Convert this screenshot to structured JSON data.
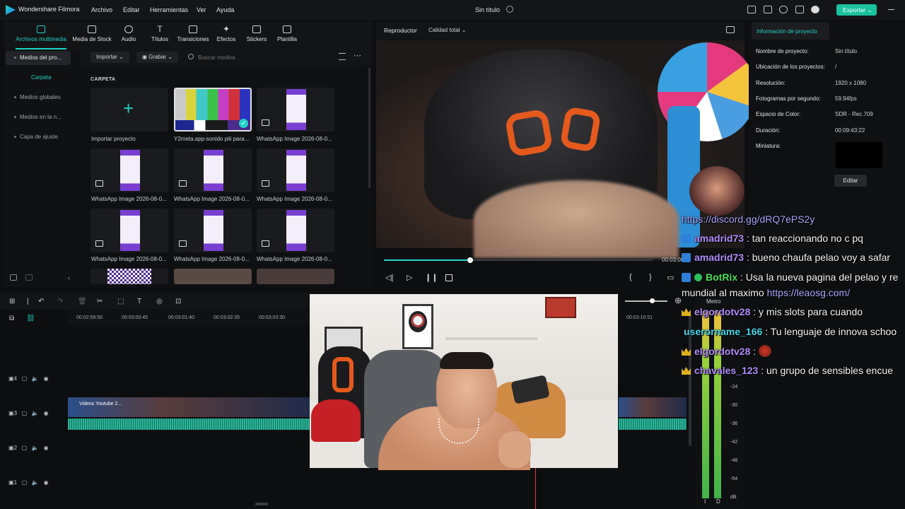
{
  "app": {
    "name": "Wondershare Filmora",
    "menu": [
      "Archivo",
      "Editar",
      "Herramientas",
      "Ver",
      "Ayuda"
    ],
    "document_title": "Sin título",
    "export_label": "Exportar"
  },
  "media_tabs": [
    "Archivos multimedia",
    "Media de Stock",
    "Audio",
    "Títulos",
    "Transiciones",
    "Efectos",
    "Stickers",
    "Plantilla"
  ],
  "left_nav": {
    "root": "Medios del pro...",
    "folder": "Carpeta",
    "items": [
      "Medios globales",
      "Medios en la n...",
      "Capa de ajuste"
    ]
  },
  "media_filter": {
    "import_label": "Importar",
    "record_label": "Grabar",
    "search_placeholder": "Buscar medios"
  },
  "media_grid": {
    "heading": "CARPETA",
    "items": [
      "Importar proyecto",
      "Y2meta.app-sonido piii para...",
      "WhatsApp Image 2026-08-0...",
      "WhatsApp Image 2026-08-0...",
      "WhatsApp Image 2026-08-0...",
      "WhatsApp Image 2026-08-0...",
      "WhatsApp Image 2026-08-0...",
      "WhatsApp Image 2026-08-0...",
      "WhatsApp Image 2026-08-0..."
    ]
  },
  "player": {
    "tab": "Reproductor",
    "quality": "Calidad total",
    "timecode": "00:03:00",
    "progress": 0.32
  },
  "properties": {
    "tab": "Información de proyecto",
    "rows": [
      {
        "label": "Nombre de proyecto:",
        "value": "Sin título"
      },
      {
        "label": "Ubicación de los proyectos:",
        "value": "/"
      },
      {
        "label": "Resolución:",
        "value": "1920 x 1080"
      },
      {
        "label": "Fotogramas por segundo:",
        "value": "59.94fps"
      },
      {
        "label": "Espacio de Color:",
        "value": "SDR - Rec.709"
      },
      {
        "label": "Duración:",
        "value": "00:09:43:22"
      },
      {
        "label": "Miniatura:",
        "value": ""
      }
    ],
    "edit_label": "Editar"
  },
  "timeline": {
    "ticks": [
      "00:02:59:50",
      "00:03:00:45",
      "00:03:01:40",
      "00:03:02:35",
      "00:03:03:30"
    ],
    "tick_right": "00:03:10:51",
    "tracks": [
      "4",
      "3",
      "2",
      "1"
    ],
    "clip_label": "Videos Youtube 2..."
  },
  "meter": {
    "title": "Metro",
    "db_labels": [
      "-24",
      "-30",
      "-36",
      "-42",
      "-48",
      "-54",
      "dB"
    ],
    "channels": [
      "I",
      "D"
    ]
  },
  "chat": [
    {
      "user": "",
      "text": "https://discord.gg/dRQ7ePS2y",
      "link": true
    },
    {
      "user": "amadrid73",
      "text": ": tan reaccionando no c pq"
    },
    {
      "user": "amadrid73",
      "text": ": bueno chaufa pelao voy a safar"
    },
    {
      "user": "BotRix",
      "text": ": Usa la nueva pagina del pelao y re"
    },
    {
      "user": "",
      "text": "mundial al maximo ",
      "link_text": "https://leaosg.com/"
    },
    {
      "user": "elgordotv28",
      "text": ": y mis slots para cuando"
    },
    {
      "user": "userorname_166",
      "text": ": Tu lenguaje de innova schoo"
    },
    {
      "user": "elgordotv28",
      "text": ":"
    },
    {
      "user": "chavales_123",
      "text": ": un grupo de sensibles encue"
    }
  ],
  "colors": {
    "accent": "#1fd3c6",
    "export": "#19c2a0",
    "chat_user_purple": "#b18cff",
    "chat_user_cyan": "#3fd7e8",
    "botrix_green": "#4be15a"
  }
}
